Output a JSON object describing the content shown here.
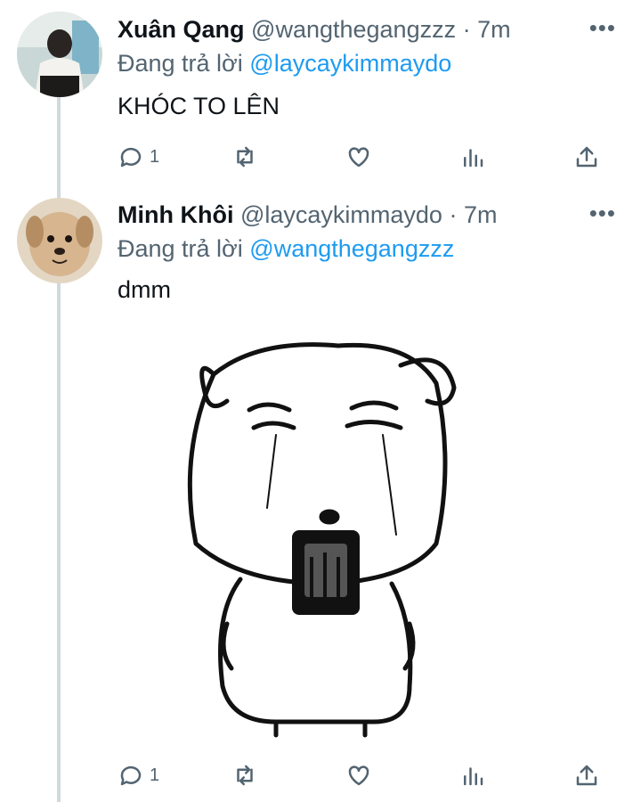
{
  "tweets": [
    {
      "name": "Xuân Qang",
      "handle": "@wangthegangzzz",
      "time": "· 7m",
      "reply_prefix": "Đang trả lời",
      "reply_to": "@laycaykimmaydo",
      "text": "KHÓC TO LÊN",
      "reply_count": "1",
      "more": "•••"
    },
    {
      "name": "Minh Khôi",
      "handle": "@laycaykimmaydo",
      "time": "· 7m",
      "reply_prefix": "Đang trả lời",
      "reply_to": "@wangthegangzzz",
      "text": "dmm",
      "reply_count": "1",
      "more": "•••"
    }
  ],
  "icons": [
    "reply-icon",
    "retweet-icon",
    "like-icon",
    "analytics-icon",
    "share-icon",
    "more-icon"
  ],
  "colors": {
    "mention": "#1d9bf0",
    "muted": "#536471",
    "thread_line": "#cfd9de"
  }
}
